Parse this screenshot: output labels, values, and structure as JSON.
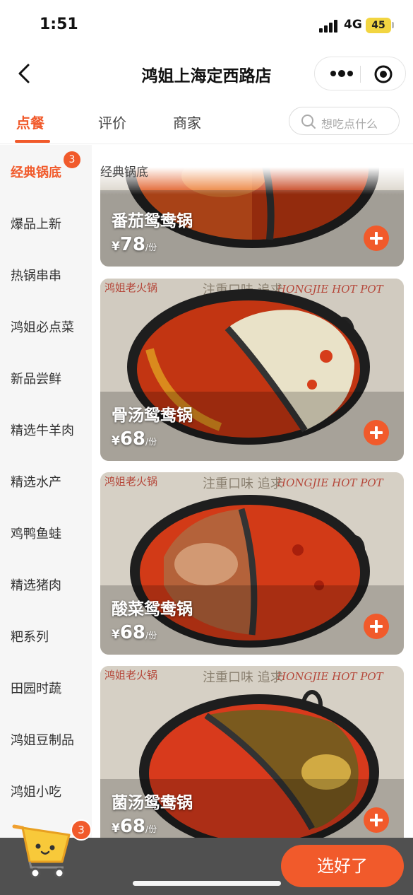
{
  "status_bar": {
    "time": "1:51",
    "network": "4G",
    "battery": "45"
  },
  "nav": {
    "title": "鸿姐上海定西路店"
  },
  "tabs": [
    {
      "label": "点餐",
      "active": true
    },
    {
      "label": "评价",
      "active": false
    },
    {
      "label": "商家",
      "active": false
    }
  ],
  "search": {
    "placeholder": "想吃点什么"
  },
  "sidebar": {
    "items": [
      {
        "label": "经典锅底",
        "active": true,
        "badge": "3"
      },
      {
        "label": "爆品上新"
      },
      {
        "label": "热锅串串"
      },
      {
        "label": "鸿姐必点菜"
      },
      {
        "label": "新品尝鲜"
      },
      {
        "label": "精选牛羊肉"
      },
      {
        "label": "精选水产"
      },
      {
        "label": "鸡鸭鱼蛙"
      },
      {
        "label": "精选猪肉"
      },
      {
        "label": "粑系列"
      },
      {
        "label": "田园时蔬"
      },
      {
        "label": "鸿姐豆制品"
      },
      {
        "label": "鸿姐小吃"
      }
    ]
  },
  "content": {
    "section_title": "经典锅底",
    "products": [
      {
        "name": "番茄鸳鸯锅",
        "currency": "¥",
        "price": "78",
        "unit": "/份"
      },
      {
        "name": "骨汤鸳鸯锅",
        "currency": "¥",
        "price": "68",
        "unit": "/份"
      },
      {
        "name": "酸菜鸳鸯锅",
        "currency": "¥",
        "price": "68",
        "unit": "/份"
      },
      {
        "name": "菌汤鸳鸯锅",
        "currency": "¥",
        "price": "68",
        "unit": "/份"
      }
    ],
    "photo_watermarks": {
      "logo": "鸿姐老火锅",
      "brand": "HONGJIE HOT POT",
      "slogan": "注重口味 追求"
    }
  },
  "cart": {
    "count": "3"
  },
  "checkout": {
    "label": "选好了"
  },
  "colors": {
    "accent": "#f15a2b",
    "sidebar_bg": "#f6f6f6",
    "bottom_bar": "#505050"
  }
}
